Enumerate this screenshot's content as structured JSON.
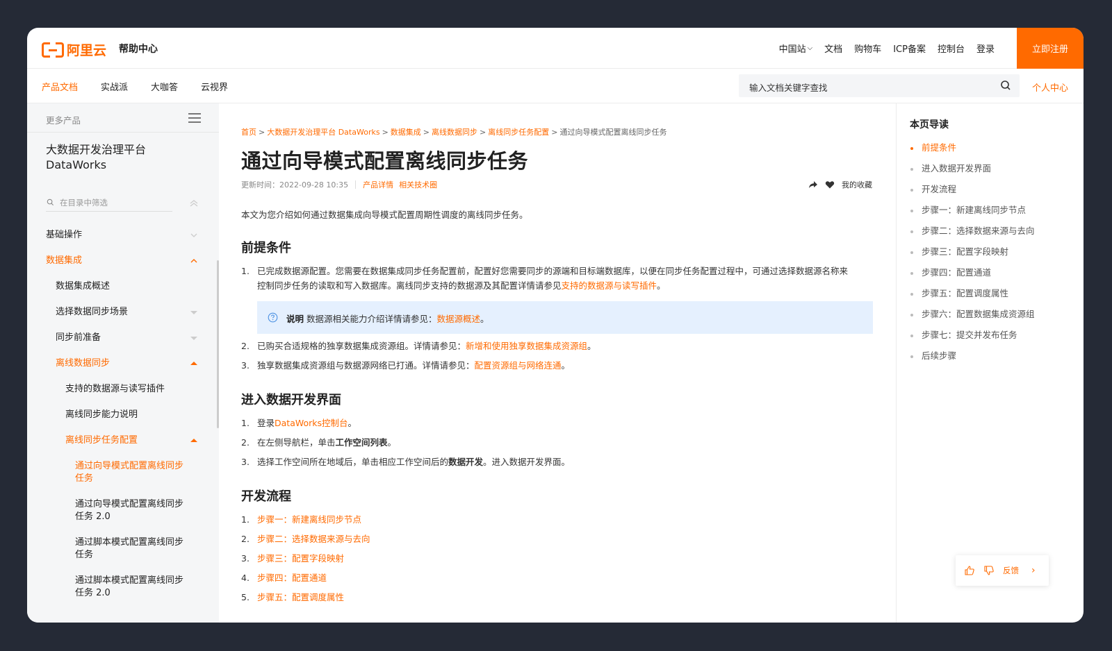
{
  "header": {
    "logo_text": "阿里云",
    "help_center": "帮助中心",
    "nav": [
      "中国站",
      "文档",
      "购物车",
      "ICP备案",
      "控制台",
      "登录"
    ],
    "register": "立即注册"
  },
  "subnav": {
    "tabs": [
      "产品文档",
      "实战派",
      "大咖答",
      "云视界"
    ],
    "search_placeholder": "输入文档关键字查找",
    "personal": "个人中心"
  },
  "sidebar": {
    "more_products": "更多产品",
    "product_title": "大数据开发治理平台 DataWorks",
    "filter_placeholder": "在目录中筛选",
    "items": [
      "基础操作",
      "数据集成",
      "数据集成概述",
      "选择数据同步场景",
      "同步前准备",
      "离线数据同步",
      "支持的数据源与读写插件",
      "离线同步能力说明",
      "离线同步任务配置",
      "通过向导模式配置离线同步任务",
      "通过向导模式配置离线同步任务 2.0",
      "通过脚本模式配置离线同步任务",
      "通过脚本模式配置离线同步任务 2.0"
    ]
  },
  "article": {
    "breadcrumb": [
      "首页",
      "大数据开发治理平台 DataWorks",
      "数据集成",
      "离线数据同步",
      "离线同步任务配置",
      "通过向导模式配置离线同步任务"
    ],
    "title": "通过向导模式配置离线同步任务",
    "updated": "更新时间：2022-09-28 10:35",
    "meta_links": [
      "产品详情",
      "相关技术圈"
    ],
    "favorite": "我的收藏",
    "intro": "本文为您介绍如何通过数据集成向导模式配置周期性调度的离线同步任务。",
    "sec1_title": "前提条件",
    "sec1": {
      "item1_text": "已完成数据源配置。您需要在数据集成同步任务配置前，配置好您需要同步的源端和目标端数据库，以便在同步任务配置过程中，可通过选择数据源名称来",
      "item1_text2": "控制同步任务的读取和写入数据库。离线同步支持的数据源及其配置详情请参见",
      "item1_link": "支持的数据源与读写插件",
      "note_label": "说明",
      "note_text": "数据源相关能力介绍详情请参见：",
      "note_link": "数据源概述",
      "item2_text": "已购买合适规格的独享数据集成资源组。详情请参见：",
      "item2_link": "新增和使用独享数据集成资源组",
      "item3_text": "独享数据集成资源组与数据源网络已打通。详情请参见：",
      "item3_link": "配置资源组与网络连通"
    },
    "sec2_title": "进入数据开发界面",
    "sec2": {
      "item1_pre": "登录",
      "item1_link": "DataWorks控制台",
      "item2_pre": "在左侧导航栏，单击",
      "item2_bold": "工作空间列表",
      "item3_pre": "选择工作空间所在地域后，单击相应工作空间后的",
      "item3_bold": "数据开发",
      "item3_post": "。进入数据开发界面。"
    },
    "sec3_title": "开发流程",
    "sec3_links": [
      "步骤一：新建离线同步节点",
      "步骤二：选择数据来源与去向",
      "步骤三：配置字段映射",
      "步骤四：配置通道",
      "步骤五：配置调度属性"
    ]
  },
  "toc": {
    "title": "本页导读",
    "items": [
      "前提条件",
      "进入数据开发界面",
      "开发流程",
      "步骤一：新建离线同步节点",
      "步骤二：选择数据来源与去向",
      "步骤三：配置字段映射",
      "步骤四：配置通道",
      "步骤五：配置调度属性",
      "步骤六：配置数据集成资源组",
      "步骤七：提交并发布任务",
      "后续步骤"
    ]
  },
  "feedback": {
    "label": "反馈"
  },
  "colors": {
    "accent": "#ff6a00",
    "background": "#252a36",
    "note_bg": "#e5f0fe"
  }
}
